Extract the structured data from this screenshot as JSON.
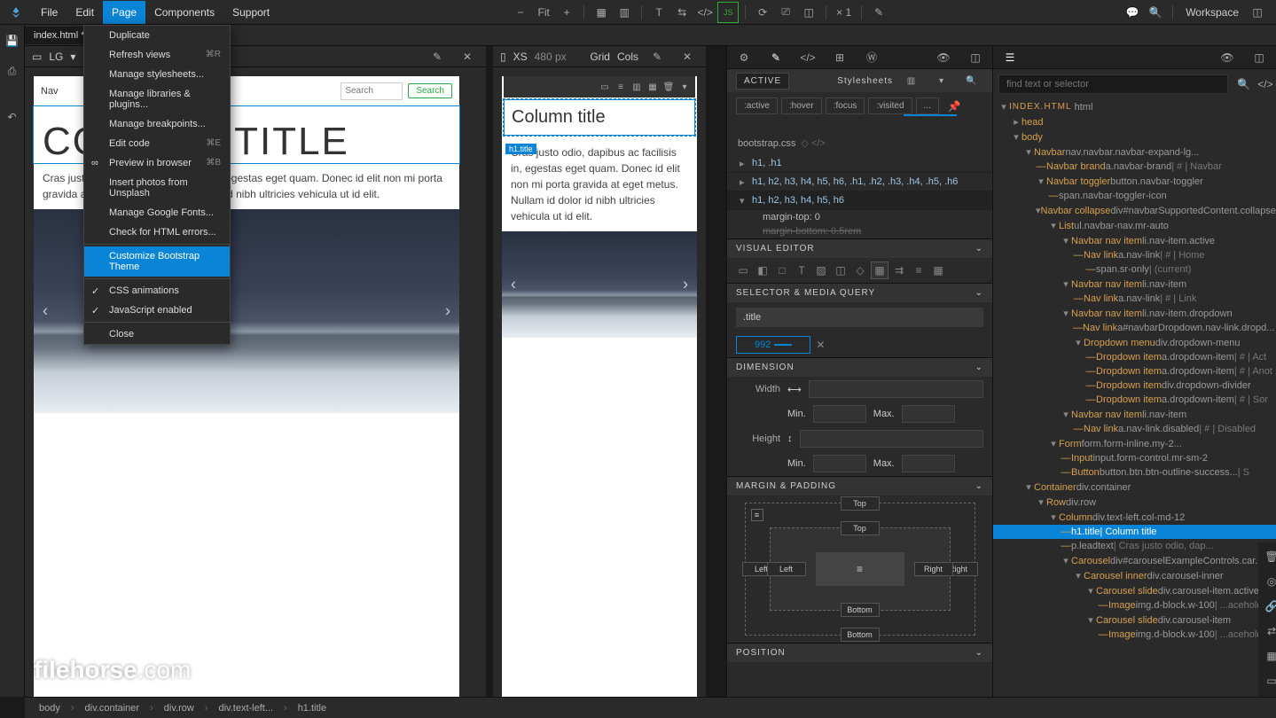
{
  "menubar": {
    "items": [
      "File",
      "Edit",
      "Page",
      "Components",
      "Support"
    ],
    "activeIndex": 2,
    "fit": "Fit",
    "zoom": "× 1",
    "workspace": "Workspace"
  },
  "tab": {
    "file": "index.html *"
  },
  "dropdown": {
    "items": [
      {
        "label": "Duplicate"
      },
      {
        "label": "Refresh views",
        "shortcut": "⌘R"
      },
      {
        "label": "Manage stylesheets..."
      },
      {
        "label": "Manage libraries & plugins..."
      },
      {
        "label": "Manage breakpoints..."
      },
      {
        "label": "Edit code",
        "shortcut": "⌘E"
      },
      {
        "label": "Preview in browser",
        "shortcut": "⌘B",
        "icon": true
      },
      {
        "label": "Insert photos from Unsplash"
      },
      {
        "label": "Manage Google Fonts..."
      },
      {
        "label": "Check for HTML errors..."
      },
      {
        "sep": true
      },
      {
        "label": "Customize Bootstrap Theme",
        "highlighted": true
      },
      {
        "sep": true
      },
      {
        "label": "CSS animations",
        "checked": true
      },
      {
        "label": "JavaScript enabled",
        "checked": true
      },
      {
        "sep": true
      },
      {
        "label": "Close"
      }
    ]
  },
  "canvasLG": {
    "size": "LG",
    "chev": "▾",
    "title": "COLUMN TITLE",
    "selLabel": "h1.title",
    "navLabel": "Nav",
    "searchPlaceholder": "Search",
    "searchBtn": "Search",
    "lead": "Cras justo odio, dapibus ac facilisis in, egestas eget quam. Donec id elit non mi porta gravida at eget metus. Nullam id dolor id nibh ultricies vehicula ut id elit."
  },
  "canvasXS": {
    "size": "XS",
    "px": "480 px",
    "grid": "Grid",
    "cols": "Cols",
    "title": "Column title",
    "selLabel": "h1.title",
    "lead": "Cras justo odio, dapibus ac facilisis in, egestas eget quam. Donec id elit non mi porta gravida at eget metus. Nullam id dolor id nibh ultricies vehicula ut id elit."
  },
  "styles": {
    "active": "ACTIVE",
    "stylesheets": "Stylesheets",
    "pseudo": [
      ":active",
      ":hover",
      ":focus",
      ":visited"
    ],
    "file": "bootstrap.css",
    "rules": [
      {
        "sel": "h1, .h1"
      },
      {
        "sel": "h1, h2, h3, h4, h5, h6, .h1, .h2, .h3, .h4, .h5, .h6"
      },
      {
        "sel": "h1, h2, h3, h4, h5, h6",
        "open": true,
        "props": [
          {
            "t": "margin-top: 0"
          },
          {
            "t": "margin-bottom: 0.5rem",
            "s": true
          }
        ]
      }
    ],
    "visual": "VISUAL EDITOR",
    "selmq": "SELECTOR & MEDIA QUERY",
    "selector": ".title",
    "media": "992",
    "dimension": "DIMENSION",
    "width": "Width",
    "height": "Height",
    "min": "Min.",
    "max": "Max.",
    "marginpad": "MARGIN & PADDING",
    "top": "Top",
    "left": "Left",
    "right": "Right",
    "bottom": "Bottom",
    "position": "POSITION"
  },
  "tree": {
    "searchPlaceholder": "find text or selector",
    "root": "INDEX.HTML",
    "rootTag": "html",
    "rows": [
      {
        "d": 1,
        "tw": "▸",
        "tag": "head"
      },
      {
        "d": 1,
        "tw": "▾",
        "tag": "body"
      },
      {
        "d": 2,
        "tw": "▾",
        "tag": "Navbar",
        "cls": "nav.navbar.navbar-expand-lg..."
      },
      {
        "d": 3,
        "dash": true,
        "tag": "Navbar brand",
        "cls": "a.navbar-brand",
        "extra": " | # | Navbar"
      },
      {
        "d": 3,
        "tw": "▾",
        "tag": "Navbar toggler",
        "cls": "button.navbar-toggler"
      },
      {
        "d": 4,
        "dash": true,
        "tag": "",
        "cls": "span.navbar-toggler-icon"
      },
      {
        "d": 3,
        "tw": "▾",
        "tag": "Navbar collapse",
        "cls": "div#navbarSupportedContent.collapse"
      },
      {
        "d": 4,
        "tw": "▾",
        "tag": "List",
        "cls": "ul.navbar-nav.mr-auto"
      },
      {
        "d": 5,
        "tw": "▾",
        "tag": "Navbar nav item",
        "cls": "li.nav-item.active"
      },
      {
        "d": 6,
        "dash": true,
        "tag": "Nav link",
        "cls": "a.nav-link",
        "extra": " | # | Home"
      },
      {
        "d": 7,
        "dash": true,
        "tag": "",
        "cls": "span.sr-only",
        "extra": " | (current)"
      },
      {
        "d": 5,
        "tw": "▾",
        "tag": "Navbar nav item",
        "cls": "li.nav-item"
      },
      {
        "d": 6,
        "dash": true,
        "tag": "Nav link",
        "cls": "a.nav-link",
        "extra": " | # | Link"
      },
      {
        "d": 5,
        "tw": "▾",
        "tag": "Navbar nav item",
        "cls": "li.nav-item.dropdown"
      },
      {
        "d": 6,
        "dash": true,
        "tag": "Nav link",
        "cls": "a#navbarDropdown.nav-link.dropd..."
      },
      {
        "d": 6,
        "tw": "▾",
        "tag": "Dropdown menu",
        "cls": "div.dropdown-menu"
      },
      {
        "d": 7,
        "dash": true,
        "tag": "Dropdown item",
        "cls": "a.dropdown-item",
        "extra": " | # | Act"
      },
      {
        "d": 7,
        "dash": true,
        "tag": "Dropdown item",
        "cls": "a.dropdown-item",
        "extra": " | # | Anot"
      },
      {
        "d": 7,
        "dash": true,
        "tag": "Dropdown item",
        "cls": "div.dropdown-divider"
      },
      {
        "d": 7,
        "dash": true,
        "tag": "Dropdown item",
        "cls": "a.dropdown-item",
        "extra": " | # | Sor"
      },
      {
        "d": 5,
        "tw": "▾",
        "tag": "Navbar nav item",
        "cls": "li.nav-item"
      },
      {
        "d": 6,
        "dash": true,
        "tag": "Nav link",
        "cls": "a.nav-link.disabled",
        "extra": " | # | Disabled"
      },
      {
        "d": 4,
        "tw": "▾",
        "tag": "Form",
        "cls": "form.form-inline.my-2..."
      },
      {
        "d": 5,
        "dash": true,
        "tag": "Input",
        "cls": "input.form-control.mr-sm-2"
      },
      {
        "d": 5,
        "dash": true,
        "tag": "Button",
        "cls": "button.btn.btn-outline-success...",
        "extra": " | S"
      },
      {
        "d": 2,
        "tw": "▾",
        "tag": "Container",
        "cls": "div.container"
      },
      {
        "d": 3,
        "tw": "▾",
        "tag": "Row",
        "cls": "div.row"
      },
      {
        "d": 4,
        "tw": "▾",
        "tag": "Column",
        "cls": "div.text-left.col-md-12"
      },
      {
        "d": 5,
        "dash": true,
        "tag": "h1.title",
        "extra": " | Column title",
        "selected": true
      },
      {
        "d": 5,
        "dash": true,
        "tag": "",
        "cls": "p.leadtext",
        "extra": " | Cras justo odio, dap..."
      },
      {
        "d": 5,
        "tw": "▾",
        "tag": "Carousel",
        "cls": "div#carouselExampleControls.car..."
      },
      {
        "d": 6,
        "tw": "▾",
        "tag": "Carousel inner",
        "cls": "div.carousel-inner"
      },
      {
        "d": 7,
        "tw": "▾",
        "tag": "Carousel slide",
        "cls": "div.carousel-item.active"
      },
      {
        "d": 8,
        "dash": true,
        "tag": "Image",
        "cls": "img.d-block.w-100",
        "extra": " | ...aceholder"
      },
      {
        "d": 7,
        "tw": "▾",
        "tag": "Carousel slide",
        "cls": "div.carousel-item"
      },
      {
        "d": 8,
        "dash": true,
        "tag": "Image",
        "cls": "img.d-block.w-100",
        "extra": " | ...aceholder"
      }
    ]
  },
  "breadcrumb": [
    "body",
    "div.container",
    "div.row",
    "div.text-left...",
    "h1.title"
  ],
  "watermark": {
    "a": "filehorse",
    "b": ".com"
  }
}
